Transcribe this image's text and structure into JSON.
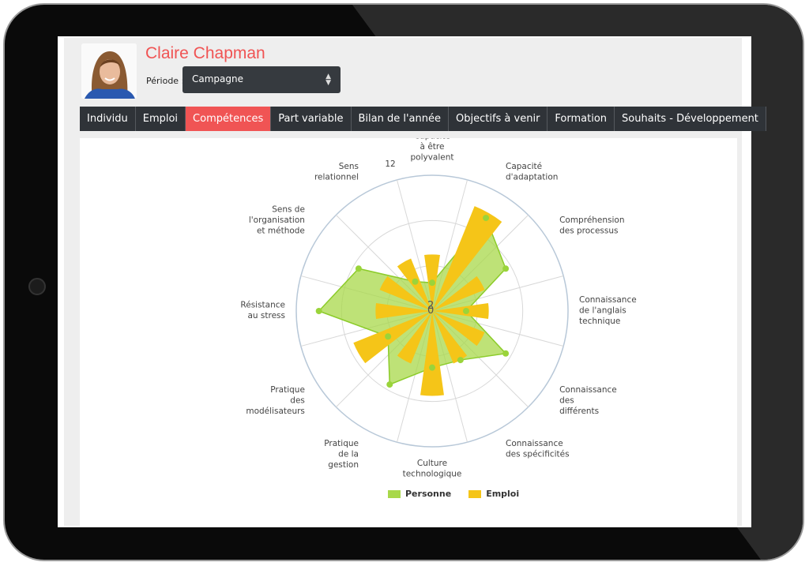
{
  "user": {
    "name": "Claire Chapman"
  },
  "period": {
    "label": "Période :",
    "value": "Campagne"
  },
  "tabs": [
    {
      "label": "Individu"
    },
    {
      "label": "Emploi"
    },
    {
      "label": "Compétences",
      "active": true
    },
    {
      "label": "Part variable"
    },
    {
      "label": "Bilan de l'année"
    },
    {
      "label": "Objectifs à venir"
    },
    {
      "label": "Formation"
    },
    {
      "label": "Souhaits - Développement"
    }
  ],
  "colors": {
    "accent": "#f05454",
    "personne": "#a8d84a",
    "emploi": "#f5c518",
    "tab_bg": "#2f3338"
  },
  "chart_data": {
    "type": "polar-radar",
    "categories": [
      [
        "Capacité",
        "à être",
        "polyvalent"
      ],
      [
        "Capacité",
        "d'adaptation"
      ],
      [
        "Compréhension",
        "des processus"
      ],
      [
        "Connaissance",
        "de l'anglais",
        "technique"
      ],
      [
        "Connaissance",
        "des",
        "différents"
      ],
      [
        "Connaissance",
        "des spécificités"
      ],
      [
        "Culture",
        "technologique"
      ],
      [
        "Pratique",
        "de la",
        "gestion"
      ],
      [
        "Pratique",
        "des",
        "modélisateurs"
      ],
      [
        "Résistance",
        "au stress"
      ],
      [
        "Sens de",
        "l'organisation",
        "et méthode"
      ],
      [
        "Sens",
        "relationnel"
      ]
    ],
    "axis_labels": {
      "max": "12",
      "a": "2",
      "b": "0"
    },
    "ylim": [
      0,
      12
    ],
    "series": [
      {
        "name": "Personne",
        "type": "area",
        "values": [
          2.5,
          9.5,
          7.5,
          3,
          7.5,
          5,
          5,
          7.5,
          4.5,
          10,
          7.5,
          3
        ]
      },
      {
        "name": "Emploi",
        "type": "column",
        "values": [
          5,
          10,
          5,
          5,
          5,
          5,
          7.5,
          5,
          7.5,
          5,
          5,
          5
        ]
      }
    ],
    "legend": "bottom-center"
  }
}
